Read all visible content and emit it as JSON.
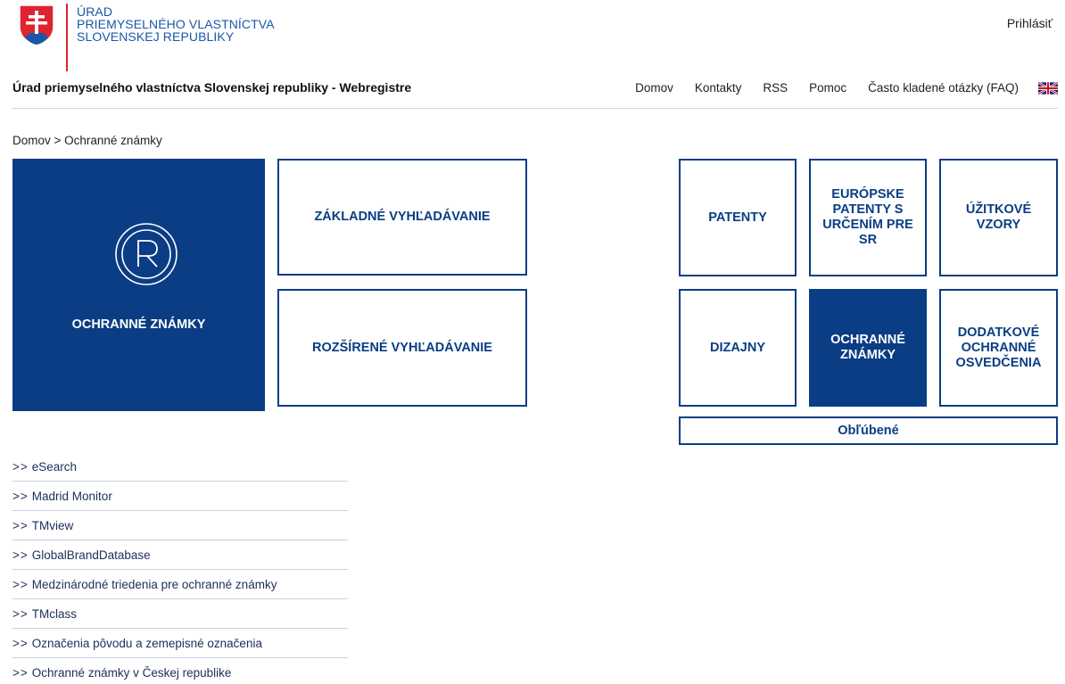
{
  "header": {
    "logo_lines": [
      "ÚRAD",
      "PRIEMYSELNÉHO VLASTNÍCTVA",
      "SLOVENSKEJ REPUBLIKY"
    ],
    "login": "Prihlásiť",
    "site_title": "Úrad priemyselného vlastníctva Slovenskej republiky - Webregistre",
    "nav": [
      "Domov",
      "Kontakty",
      "RSS",
      "Pomoc",
      "Často kladené otázky (FAQ)"
    ]
  },
  "breadcrumb": "Domov > Ochranné známky",
  "section": {
    "title": "OCHRANNÉ ZNÁMKY",
    "basic_search": "ZÁKLADNÉ VYHĽADÁVANIE",
    "advanced_search": "ROZŠÍRENÉ VYHĽADÁVANIE"
  },
  "categories": {
    "patents": "PATENTY",
    "european_patents": "EURÓPSKE PATENTY S URČENÍM PRE SR",
    "utility_models": "ÚŽITKOVÉ VZORY",
    "designs": "DIZAJNY",
    "trademarks": "OCHRANNÉ ZNÁMKY",
    "spc": "DODATKOVÉ OCHRANNÉ OSVEDČENIA",
    "favorites": "Obľúbené"
  },
  "links": {
    "arrow": ">>",
    "items": [
      "eSearch",
      "Madrid Monitor",
      "TMview",
      "GlobalBrandDatabase",
      "Medzinárodné triedenia pre ochranné známky",
      "TMclass",
      "Označenia pôvodu a zemepisné označenia",
      "Ochranné známky v Českej republike"
    ]
  },
  "colors": {
    "primary": "#0a3d84",
    "logo_blue": "#1a57a8",
    "logo_red": "#e0242f"
  }
}
